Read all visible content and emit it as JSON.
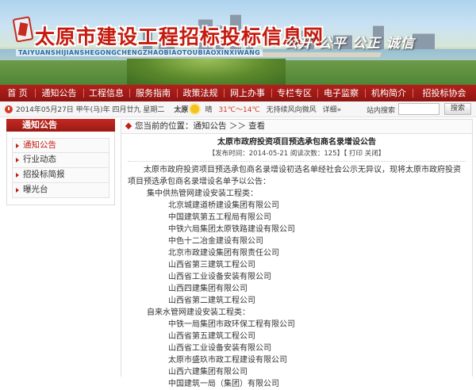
{
  "banner": {
    "title": "太原市建设工程招标投标信息网",
    "pinyin": "TAIYUANSHIJIANSHEGONGCHENGZHAOBIAOTOUBIAOXINXIWANG",
    "slogan": "公开 公平 公正 诚信"
  },
  "nav": [
    "首 页",
    "通知公告",
    "工程信息",
    "服务指南",
    "政策法规",
    "网上办事",
    "专栏专区",
    "电子监察",
    "机构简介",
    "招投标协会"
  ],
  "infobar": {
    "date": "2014年05月27日 甲午(马)年 四月廿九 星期二",
    "city": "太原",
    "weather": "晴",
    "temp": "31℃～14℃",
    "wind": "无持续风向微风",
    "detail_link": "详细»",
    "search_label": "站内搜索",
    "search_placeholder": "",
    "search_button": "搜索"
  },
  "sidebar": {
    "heading": "通知公告",
    "items": [
      "通知公告",
      "行业动态",
      "招投标简报",
      "曝光台"
    ],
    "active_index": 0
  },
  "breadcrumb": {
    "text": "您当前的位置：通知公告 ＞＞ 查看"
  },
  "article": {
    "title": "太原市政府投资项目预选承包商名录增设公告",
    "meta": "【发布时间：2014-05-21 阅读次数：125】【 打印 关闭】",
    "intro": "太原市政府投资项目预选承包商名录增设初选名单经社会公示无异议，现将太原市政府投资项目预选承包商名录增设名单予以公告：",
    "groups": [
      {
        "title": "集中供热管网建设安装工程类：",
        "companies": [
          "北京城建道桥建设集团有限公司",
          "中国建筑第五工程局有限公司",
          "中铁六局集团太原铁路建设有限公司",
          "中色十二冶金建设有限公司",
          "北京市政建设集团有限责任公司",
          "山西省第三建筑工程公司",
          "山西省工业设备安装有限公司",
          "山西四建集团有限公司",
          "山西省第二建筑工程公司"
        ]
      },
      {
        "title": "自来水管网建设安装工程类：",
        "companies": [
          "中铁一局集团市政环保工程有限公司",
          "山西省第五建筑工程公司",
          "山西省工业设备安装有限公司",
          "太原市盛玖市政工程建设有限公司",
          "山西六建集团有限公司",
          "中国建筑一局（集团）有限公司"
        ]
      }
    ]
  },
  "colors": {
    "brand_red": "#b4201c",
    "title_red": "#c61a0e",
    "temp_red": "#d4372a"
  }
}
